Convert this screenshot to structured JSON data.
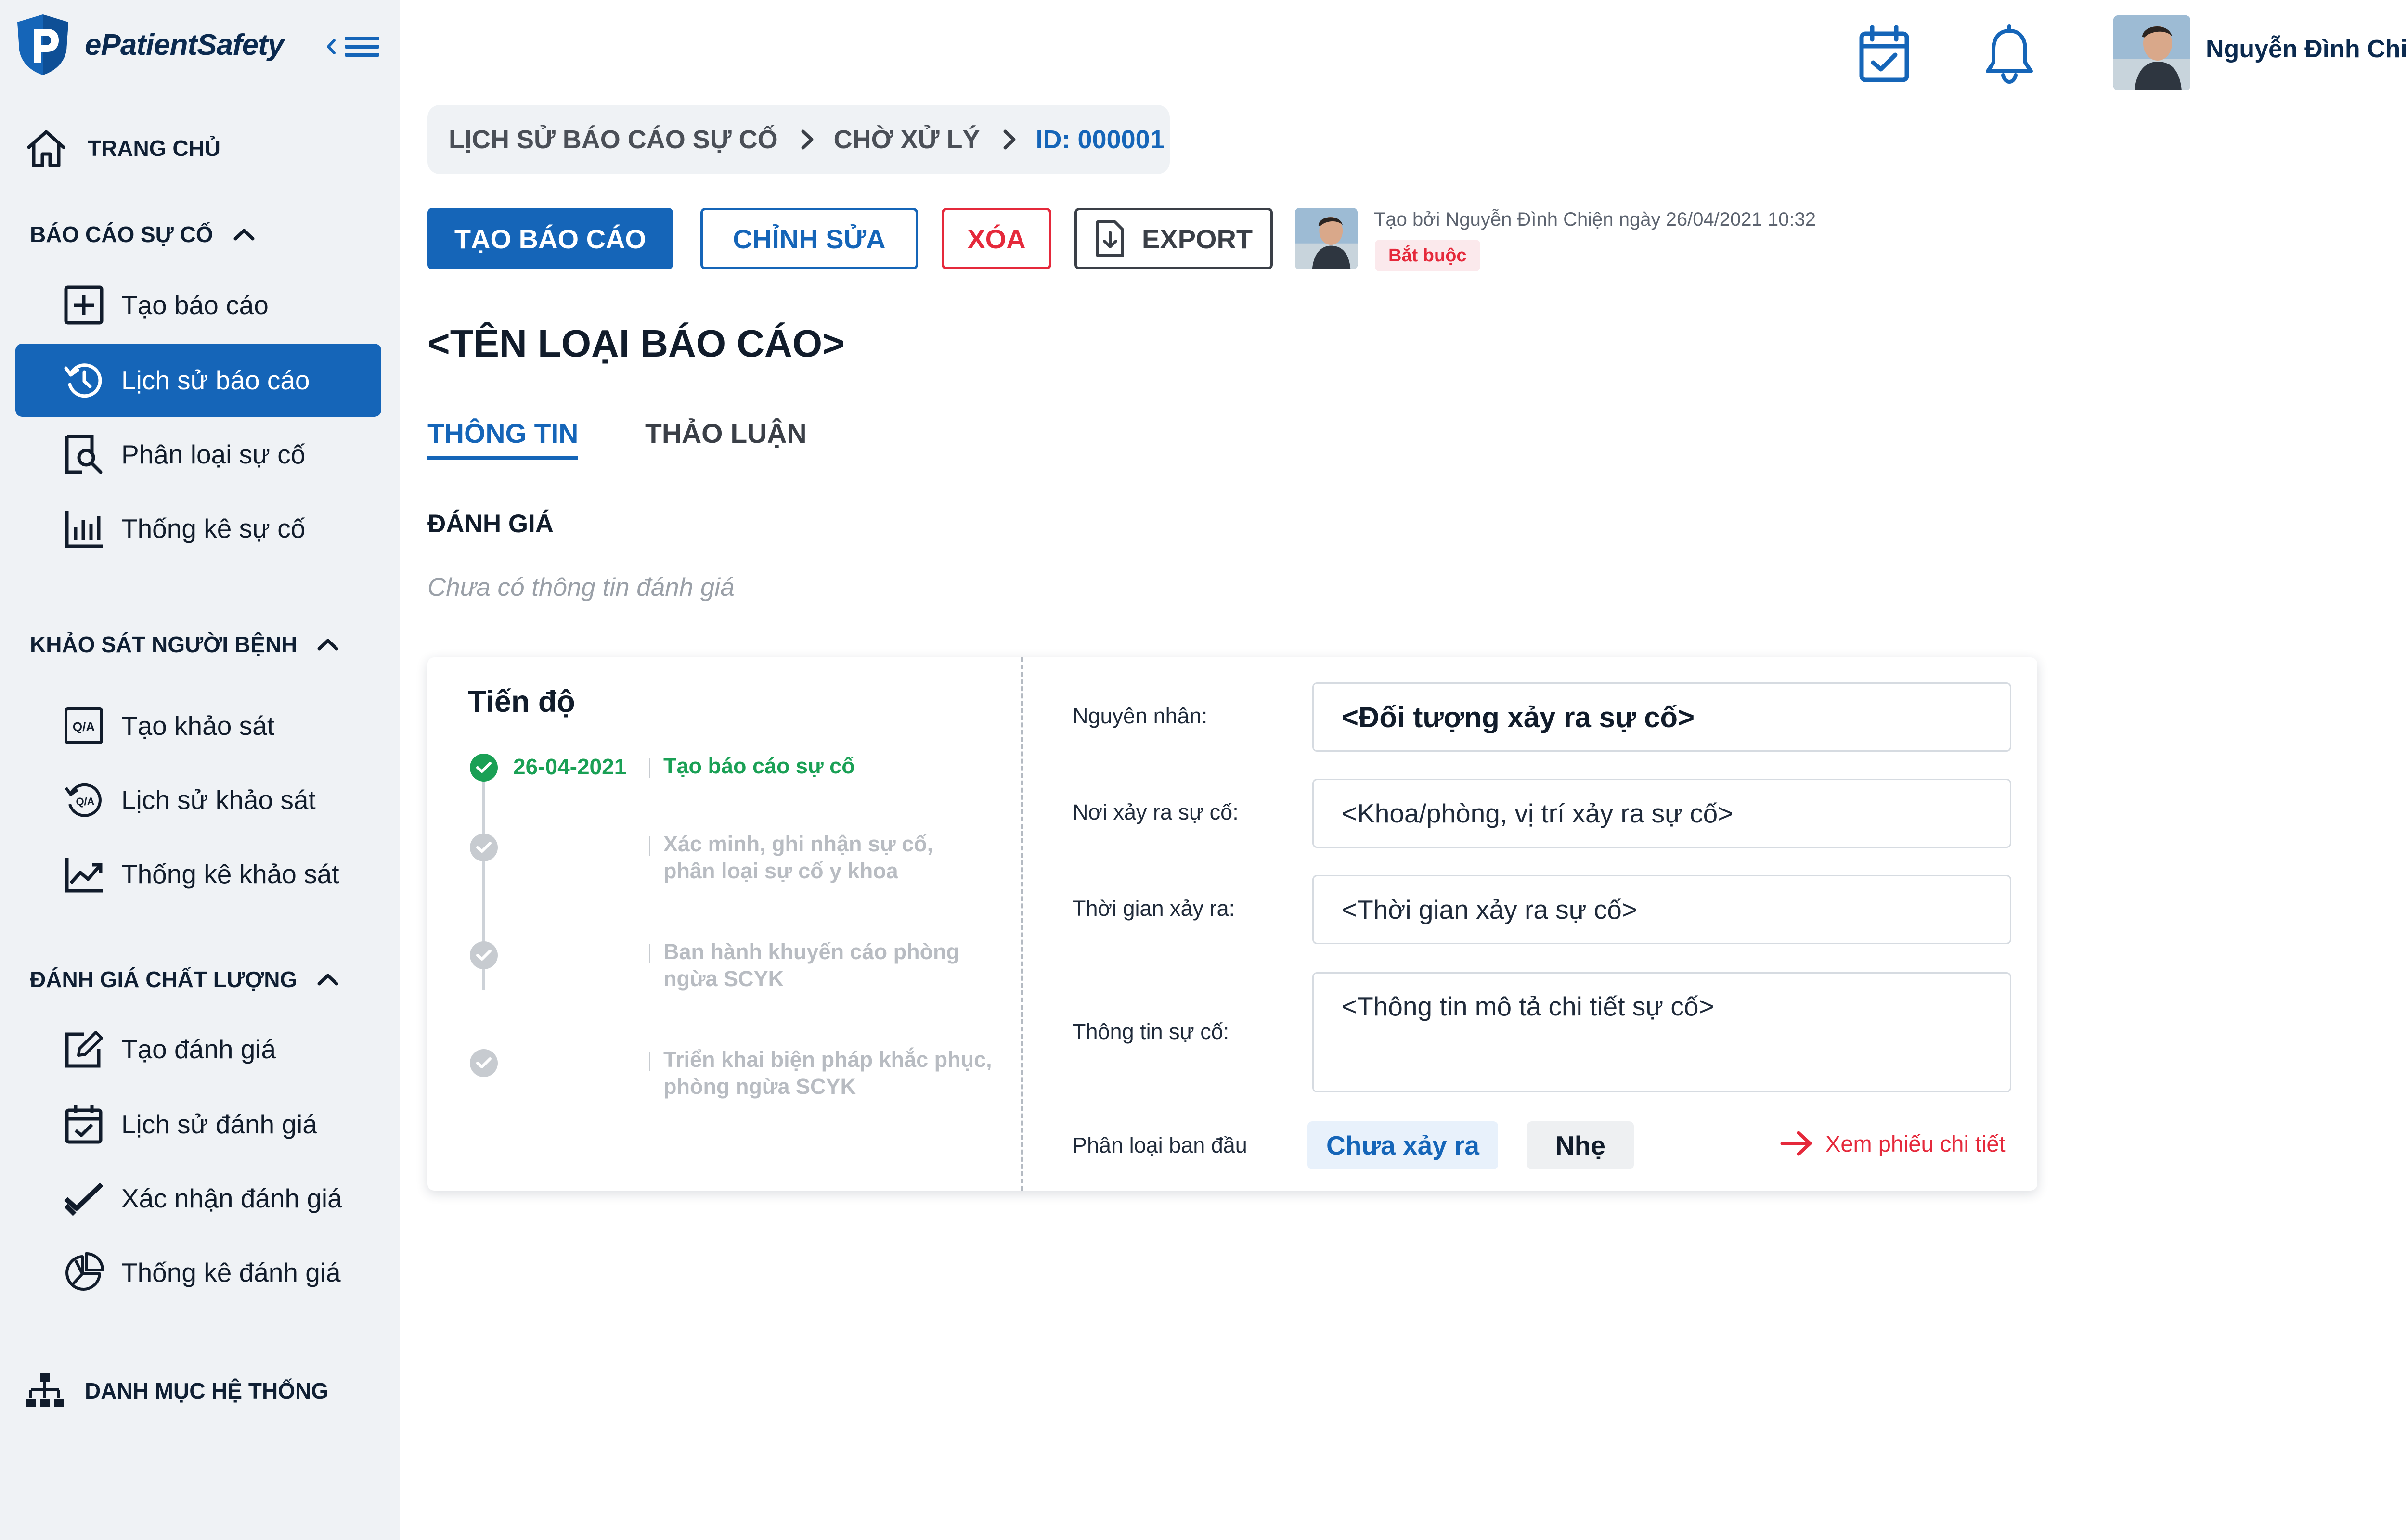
{
  "app": {
    "name": "ePatientSafety"
  },
  "nav": {
    "home": "TRANG CHỦ",
    "section_incident": "BÁO CÁO SỰ CỐ",
    "incident_items": [
      "Tạo báo cáo",
      "Lịch sử báo cáo",
      "Phân loại sự cố",
      "Thống kê sự cố"
    ],
    "section_survey": "KHẢO SÁT NGƯỜI BỆNH",
    "survey_items": [
      "Tạo khảo sát",
      "Lịch sử khảo sát",
      "Thống kê khảo sát"
    ],
    "section_quality": "ĐÁNH GIÁ CHẤT LƯỢNG",
    "quality_items": [
      "Tạo đánh giá",
      "Lịch sử đánh giá",
      "Xác nhận đánh giá",
      "Thống kê đánh giá"
    ],
    "system": "DANH MỤC HỆ THỐNG",
    "active_item": "Lịch sử báo cáo"
  },
  "header": {
    "user_name": "Nguyễn Đình Chiện"
  },
  "breadcrumb": {
    "items": [
      "LỊCH SỬ BÁO CÁO SỰ CỐ",
      "CHỜ XỬ LÝ"
    ],
    "current": "ID: 000001"
  },
  "actions": {
    "create": "TẠO BÁO CÁO",
    "edit": "CHỈNH SỬA",
    "delete": "XÓA",
    "export": "EXPORT"
  },
  "meta": {
    "created_by": "Tạo bởi Nguyễn Đình Chiện ngày 26/04/2021 10:32",
    "badge": "Bắt buộc"
  },
  "page": {
    "title": "<TÊN LOẠI BÁO CÁO>"
  },
  "tabs": {
    "info": "THÔNG TIN",
    "discussion": "THẢO LUẬN",
    "active": "THÔNG TIN"
  },
  "evaluation": {
    "title": "ĐÁNH GIÁ",
    "empty": "Chưa có thông tin đánh giá"
  },
  "progress": {
    "title": "Tiến độ",
    "steps": [
      {
        "date": "26-04-2021",
        "line1": "Tạo báo cáo sự cố",
        "line2": "",
        "status": "done"
      },
      {
        "date": "",
        "line1": "Xác  minh, ghi nhận sự cố,",
        "line2": "phân loại sự cố y khoa",
        "status": "pending"
      },
      {
        "date": "",
        "line1": "Ban hành khuyến cáo phòng",
        "line2": "ngừa SCYK",
        "status": "pending"
      },
      {
        "date": "",
        "line1": "Triển khai biện pháp khắc phục,",
        "line2": "phòng ngừa SCYK",
        "status": "pending"
      }
    ]
  },
  "details": {
    "cause_label": "Nguyên nhân:",
    "cause_value": "<Đối tượng xảy ra sự cố>",
    "place_label": "Nơi xảy ra sự cố:",
    "place_value": "<Khoa/phòng, vị trí xảy ra sự cố>",
    "time_label": "Thời gian xảy ra:",
    "time_value": "<Thời gian xảy ra sự cố>",
    "info_label": "Thông tin sự cố:",
    "info_value": "<Thông tin mô tả chi tiết sự cố>",
    "class_label": "Phân loại ban đầu",
    "class_chip_1": "Chưa xảy ra",
    "class_chip_2": "Nhẹ",
    "detail_link": "Xem phiếu chi tiết"
  },
  "colors": {
    "primary": "#1565b8",
    "danger": "#e5293b",
    "success": "#1aa055",
    "sidebar": "#eff2f5"
  }
}
